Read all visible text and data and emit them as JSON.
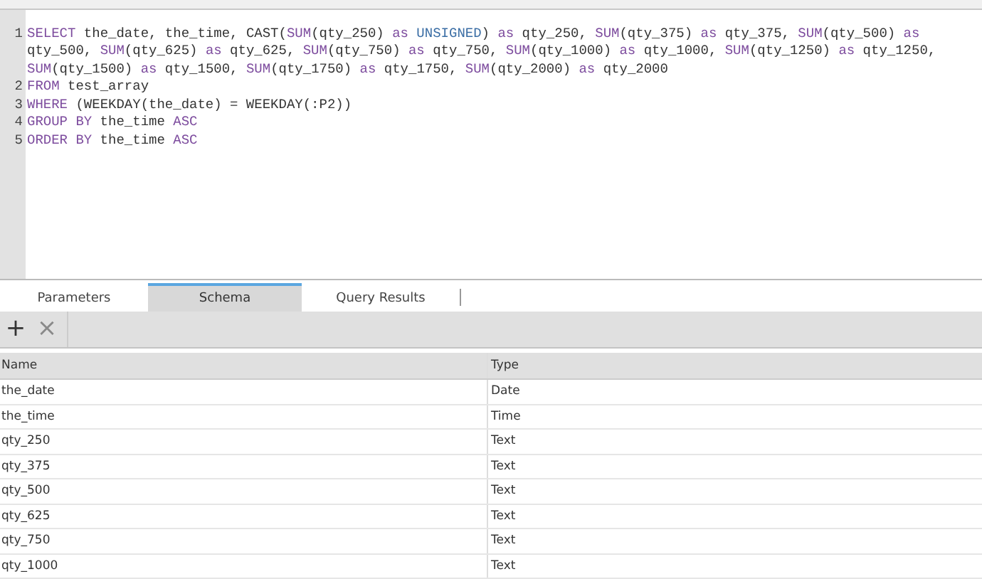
{
  "editor": {
    "lines": [
      {
        "number": "1",
        "tokens": [
          {
            "kind": "keyword",
            "text": "SELECT"
          },
          {
            "kind": "plain",
            "text": " the_date, the_time, CAST("
          },
          {
            "kind": "keyword",
            "text": "SUM"
          },
          {
            "kind": "plain",
            "text": "(qty_250) "
          },
          {
            "kind": "keyword",
            "text": "as"
          },
          {
            "kind": "type",
            "text": " UNSIGNED"
          },
          {
            "kind": "plain",
            "text": ") "
          },
          {
            "kind": "keyword",
            "text": "as"
          },
          {
            "kind": "plain",
            "text": " qty_250, "
          },
          {
            "kind": "keyword",
            "text": "SUM"
          },
          {
            "kind": "plain",
            "text": "(qty_375) "
          },
          {
            "kind": "keyword",
            "text": "as"
          },
          {
            "kind": "plain",
            "text": " qty_375, "
          },
          {
            "kind": "keyword",
            "text": "SUM"
          },
          {
            "kind": "plain",
            "text": "(qty_500) "
          },
          {
            "kind": "keyword",
            "text": "as"
          },
          {
            "kind": "plain",
            "text": " qty_500, "
          },
          {
            "kind": "keyword",
            "text": "SUM"
          },
          {
            "kind": "plain",
            "text": "(qty_625) "
          },
          {
            "kind": "keyword",
            "text": "as"
          },
          {
            "kind": "plain",
            "text": " qty_625, "
          },
          {
            "kind": "keyword",
            "text": "SUM"
          },
          {
            "kind": "plain",
            "text": "(qty_750) "
          },
          {
            "kind": "keyword",
            "text": "as"
          },
          {
            "kind": "plain",
            "text": " qty_750, "
          },
          {
            "kind": "keyword",
            "text": "SUM"
          },
          {
            "kind": "plain",
            "text": "(qty_1000) "
          },
          {
            "kind": "keyword",
            "text": "as"
          },
          {
            "kind": "plain",
            "text": " qty_1000, "
          },
          {
            "kind": "keyword",
            "text": "SUM"
          },
          {
            "kind": "plain",
            "text": "(qty_1250) "
          },
          {
            "kind": "keyword",
            "text": "as"
          },
          {
            "kind": "plain",
            "text": " qty_1250, "
          },
          {
            "kind": "keyword",
            "text": "SUM"
          },
          {
            "kind": "plain",
            "text": "(qty_1500) "
          },
          {
            "kind": "keyword",
            "text": "as"
          },
          {
            "kind": "plain",
            "text": " qty_1500, "
          },
          {
            "kind": "keyword",
            "text": "SUM"
          },
          {
            "kind": "plain",
            "text": "(qty_1750) "
          },
          {
            "kind": "keyword",
            "text": "as"
          },
          {
            "kind": "plain",
            "text": " qty_1750, "
          },
          {
            "kind": "keyword",
            "text": "SUM"
          },
          {
            "kind": "plain",
            "text": "(qty_2000) "
          },
          {
            "kind": "keyword",
            "text": "as"
          },
          {
            "kind": "plain",
            "text": " qty_2000"
          }
        ]
      },
      {
        "number": "2",
        "tokens": [
          {
            "kind": "keyword",
            "text": "FROM"
          },
          {
            "kind": "plain",
            "text": " test_array"
          }
        ]
      },
      {
        "number": "3",
        "tokens": [
          {
            "kind": "keyword",
            "text": "WHERE"
          },
          {
            "kind": "plain",
            "text": " (WEEKDAY(the_date) = WEEKDAY(:P2))"
          }
        ]
      },
      {
        "number": "4",
        "tokens": [
          {
            "kind": "keyword",
            "text": "GROUP BY"
          },
          {
            "kind": "plain",
            "text": " the_time "
          },
          {
            "kind": "keyword",
            "text": "ASC"
          }
        ]
      },
      {
        "number": "5",
        "tokens": [
          {
            "kind": "keyword",
            "text": "ORDER BY"
          },
          {
            "kind": "plain",
            "text": " the_time "
          },
          {
            "kind": "keyword",
            "text": "ASC"
          }
        ]
      }
    ]
  },
  "tabs": [
    {
      "label": "Parameters",
      "selected": false
    },
    {
      "label": "Schema",
      "selected": true
    },
    {
      "label": "Query Results",
      "selected": false
    }
  ],
  "toolbar": {
    "buttons": [
      {
        "label": "+",
        "disabled": false
      },
      {
        "label": "×",
        "disabled": true
      }
    ]
  },
  "table": {
    "columns": [
      "Name",
      "Type"
    ],
    "rows": [
      [
        "the_date",
        "Date"
      ],
      [
        "the_time",
        "Time"
      ],
      [
        "qty_250",
        "Text"
      ],
      [
        "qty_375",
        "Text"
      ],
      [
        "qty_500",
        "Text"
      ],
      [
        "qty_625",
        "Text"
      ],
      [
        "qty_750",
        "Text"
      ],
      [
        "qty_1000",
        "Text"
      ]
    ]
  }
}
